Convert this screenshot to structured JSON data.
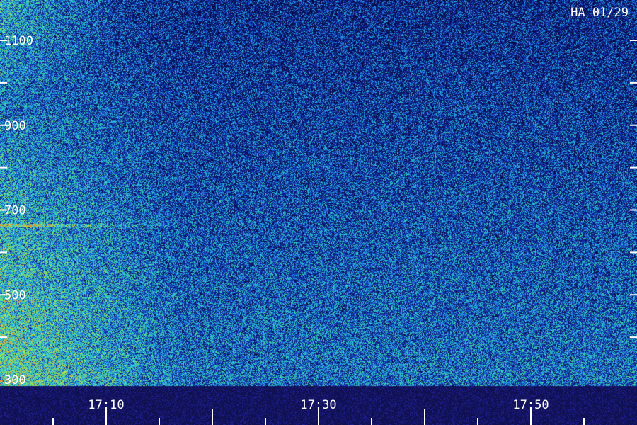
{
  "chart_data": {
    "type": "heatmap",
    "title": "HA 01/29",
    "xlabel": "",
    "ylabel": "",
    "x_tick_labels": [
      "17:10",
      "17:30",
      "17:50"
    ],
    "x_tick_minutes": [
      10,
      30,
      50
    ],
    "x_range_minutes": [
      0,
      60
    ],
    "y_tick_labels": [
      "1100",
      "900",
      "700",
      "500",
      "300"
    ],
    "y_ticks": [
      1100,
      900,
      700,
      500,
      300
    ],
    "y_range": [
      300,
      1200
    ],
    "grid": false,
    "colormap": [
      "#07073a",
      "#111a8a",
      "#1a4fd6",
      "#26b8e8",
      "#3fe0a0",
      "#b8f040",
      "#ff8020"
    ],
    "background_band_color": "#101050",
    "label_color": "#ffffff"
  }
}
